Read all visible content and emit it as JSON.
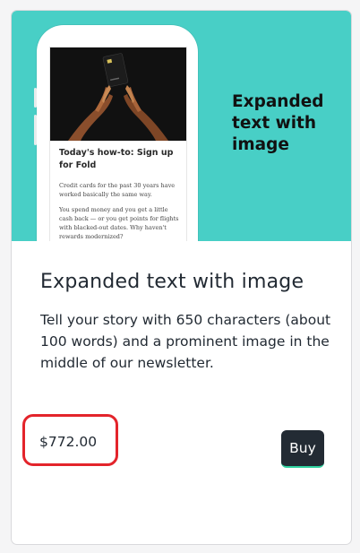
{
  "card": {
    "hero": {
      "headline_lines": [
        "Expanded",
        "text with",
        "image"
      ],
      "article": {
        "title": "Today's how-to: Sign up for Fold",
        "paragraphs": [
          "Credit cards for the past 30 years have worked basically the same way.",
          "You spend money and you get a little cash back — or you get points for flights with blacked-out dates. Why haven't rewards modernized?"
        ]
      }
    },
    "title": "Expanded text with image",
    "description": "Tell your story with 650 characters (about 100 words) and a prominent image in the middle of our newsletter.",
    "price": "$772.00",
    "buy_label": "Buy"
  },
  "colors": {
    "hero_bg": "#48cfc6",
    "buy_bg": "#232b34",
    "buy_underline": "#2fd29f",
    "price_highlight": "#e3242b"
  }
}
